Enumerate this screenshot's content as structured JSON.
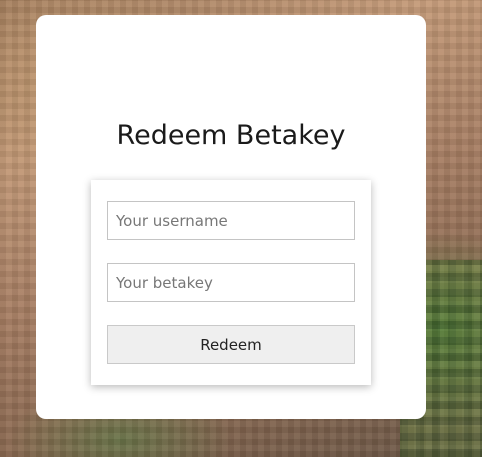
{
  "page": {
    "title": "Redeem Betakey"
  },
  "form": {
    "username": {
      "placeholder": "Your username",
      "value": ""
    },
    "betakey": {
      "placeholder": "Your betakey",
      "value": ""
    },
    "submit_label": "Redeem"
  },
  "colors": {
    "card_background": "#ffffff",
    "button_background": "#efefef",
    "input_border": "#c4c4c4"
  }
}
